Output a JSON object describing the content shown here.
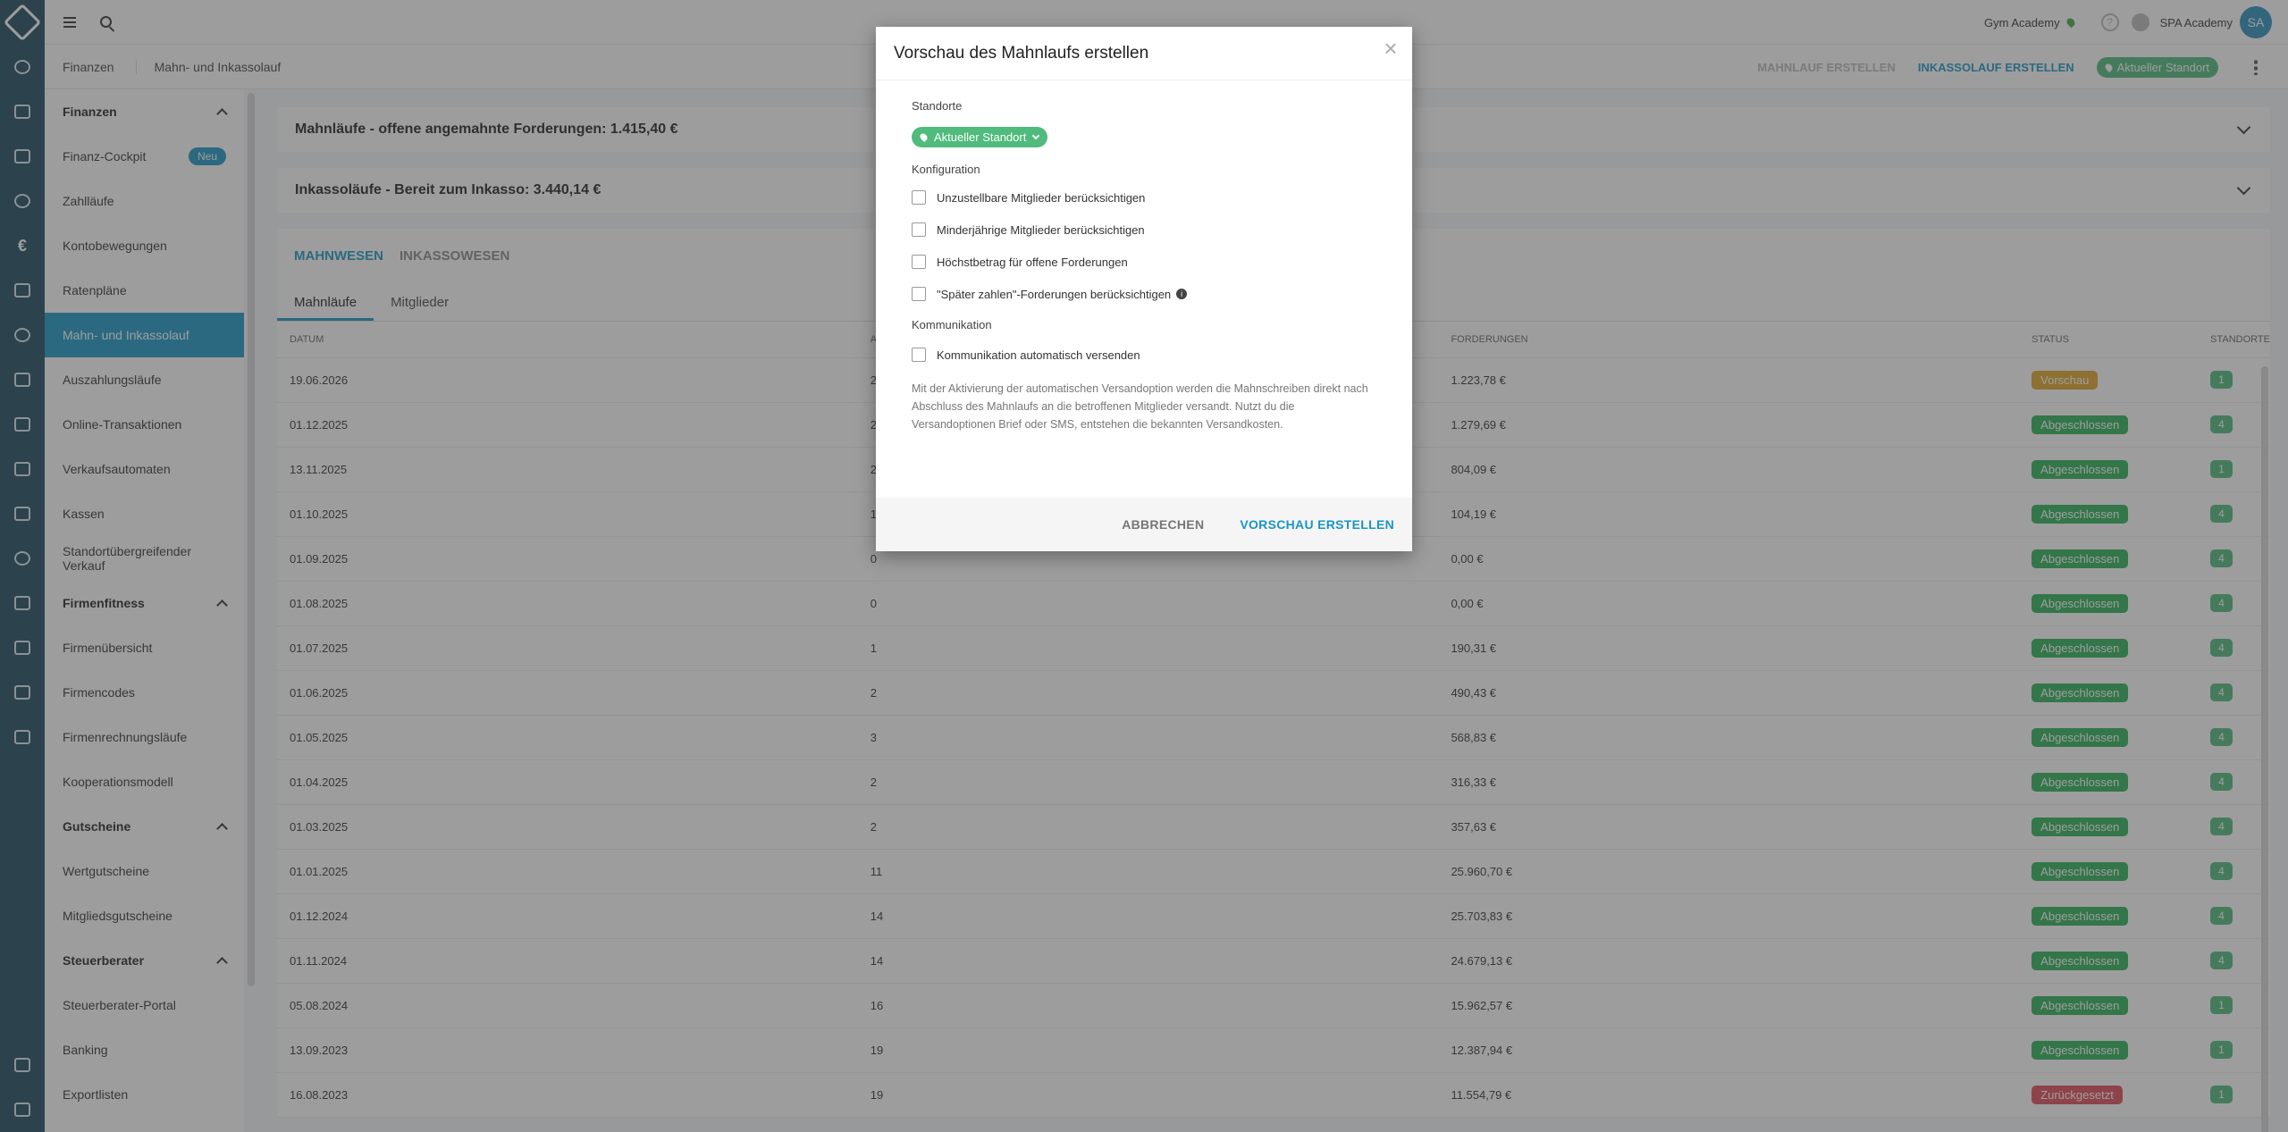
{
  "topbar": {
    "studio": "Gym Academy",
    "user": "SPA Academy",
    "avatar": "SA",
    "help_icon": "?"
  },
  "breadcrumb": [
    "Finanzen",
    "Mahn- und Inkassolauf"
  ],
  "actions": {
    "mahnlauf": "MAHNLAUF ERSTELLEN",
    "inkassolauf": "INKASSOLAUF ERSTELLEN",
    "location": "Aktueller Standort"
  },
  "sidebar": {
    "sections": [
      {
        "title": "Finanzen",
        "items": [
          {
            "label": "Finanz-Cockpit",
            "badge": "Neu"
          },
          {
            "label": "Zahlläufe"
          },
          {
            "label": "Kontobewegungen"
          },
          {
            "label": "Ratenpläne"
          },
          {
            "label": "Mahn- und Inkassolauf",
            "active": true
          },
          {
            "label": "Auszahlungsläufe"
          },
          {
            "label": "Online-Transaktionen"
          },
          {
            "label": "Verkaufsautomaten"
          },
          {
            "label": "Kassen"
          },
          {
            "label": "Standortübergreifender Verkauf"
          }
        ]
      },
      {
        "title": "Firmenfitness",
        "items": [
          {
            "label": "Firmenübersicht"
          },
          {
            "label": "Firmencodes"
          },
          {
            "label": "Firmenrechnungsläufe"
          },
          {
            "label": "Kooperationsmodell"
          }
        ]
      },
      {
        "title": "Gutscheine",
        "items": [
          {
            "label": "Wertgutscheine"
          },
          {
            "label": "Mitgliedsgutscheine"
          }
        ]
      },
      {
        "title": "Steuerberater",
        "items": [
          {
            "label": "Steuerberater-Portal"
          },
          {
            "label": "Banking"
          },
          {
            "label": "Exportlisten"
          }
        ]
      }
    ]
  },
  "panels": {
    "mahn": "Mahnläufe - offene angemahnte Forderungen: 1.415,40 €",
    "inkasso": "Inkassoläufe - Bereit zum Inkasso: 3.440,14 €"
  },
  "tabs": {
    "primary": [
      "MAHNWESEN",
      "INKASSOWESEN"
    ],
    "secondary": [
      "Mahnläufe",
      "Mitglieder"
    ]
  },
  "table": {
    "headers": [
      "DATUM",
      "A",
      "FORDERUNGEN",
      "STATUS",
      "STANDORTE"
    ],
    "rows": [
      {
        "date": "19.06.2026",
        "count": "2",
        "amount": "1.223,78 €",
        "status": "Vorschau",
        "status_type": "preview",
        "loc": "1"
      },
      {
        "date": "01.12.2025",
        "count": "2",
        "amount": "1.279,69 €",
        "status": "Abgeschlossen",
        "status_type": "ok",
        "loc": "4"
      },
      {
        "date": "13.11.2025",
        "count": "2",
        "amount": "804,09 €",
        "status": "Abgeschlossen",
        "status_type": "ok",
        "loc": "1"
      },
      {
        "date": "01.10.2025",
        "count": "1",
        "amount": "104,19 €",
        "status": "Abgeschlossen",
        "status_type": "ok",
        "loc": "4"
      },
      {
        "date": "01.09.2025",
        "count": "0",
        "amount": "0,00 €",
        "status": "Abgeschlossen",
        "status_type": "ok",
        "loc": "4"
      },
      {
        "date": "01.08.2025",
        "count": "0",
        "amount": "0,00 €",
        "status": "Abgeschlossen",
        "status_type": "ok",
        "loc": "4"
      },
      {
        "date": "01.07.2025",
        "count": "1",
        "amount": "190,31 €",
        "status": "Abgeschlossen",
        "status_type": "ok",
        "loc": "4"
      },
      {
        "date": "01.06.2025",
        "count": "2",
        "amount": "490,43 €",
        "status": "Abgeschlossen",
        "status_type": "ok",
        "loc": "4"
      },
      {
        "date": "01.05.2025",
        "count": "3",
        "amount": "568,83 €",
        "status": "Abgeschlossen",
        "status_type": "ok",
        "loc": "4"
      },
      {
        "date": "01.04.2025",
        "count": "2",
        "amount": "316,33 €",
        "status": "Abgeschlossen",
        "status_type": "ok",
        "loc": "4"
      },
      {
        "date": "01.03.2025",
        "count": "2",
        "amount": "357,63 €",
        "status": "Abgeschlossen",
        "status_type": "ok",
        "loc": "4"
      },
      {
        "date": "01.01.2025",
        "count": "11",
        "amount": "25.960,70 €",
        "status": "Abgeschlossen",
        "status_type": "ok",
        "loc": "4"
      },
      {
        "date": "01.12.2024",
        "count": "14",
        "amount": "25.703,83 €",
        "status": "Abgeschlossen",
        "status_type": "ok",
        "loc": "4"
      },
      {
        "date": "01.11.2024",
        "count": "14",
        "amount": "24.679,13 €",
        "status": "Abgeschlossen",
        "status_type": "ok",
        "loc": "4"
      },
      {
        "date": "05.08.2024",
        "count": "16",
        "amount": "15.962,57 €",
        "status": "Abgeschlossen",
        "status_type": "ok",
        "loc": "1"
      },
      {
        "date": "13.09.2023",
        "count": "19",
        "amount": "12.387,94 €",
        "status": "Abgeschlossen",
        "status_type": "ok",
        "loc": "1"
      },
      {
        "date": "16.08.2023",
        "count": "19",
        "amount": "11.554,79 €",
        "status": "Zurückgesetzt",
        "status_type": "reset",
        "loc": "1"
      }
    ]
  },
  "modal": {
    "title": "Vorschau des Mahnlaufs erstellen",
    "close": "×",
    "standorte_label": "Standorte",
    "location_chip": "Aktueller Standort",
    "config_label": "Konfiguration",
    "options": [
      "Unzustellbare Mitglieder berücksichtigen",
      "Minderjährige Mitglieder berücksichtigen",
      "Höchstbetrag für offene Forderungen",
      "\"Später zahlen\"-Forderungen berücksichtigen"
    ],
    "info_icon": "i",
    "comm_label": "Kommunikation",
    "comm_option": "Kommunikation automatisch versenden",
    "note": "Mit der Aktivierung der automatischen Versandoption werden die Mahnschreiben direkt nach Abschluss des Mahnlaufs an die betroffenen Mitglieder versandt. Nutzt du die Versandoptionen Brief oder SMS, entstehen die bekannten Versandkosten.",
    "cancel": "ABBRECHEN",
    "confirm": "VORSCHAU ERSTELLEN"
  }
}
